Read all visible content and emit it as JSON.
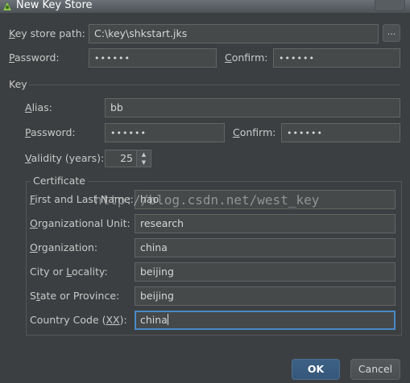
{
  "window": {
    "title": "New Key Store"
  },
  "keystore": {
    "path_label_key": "K",
    "path_label_rest": "ey store path:",
    "path_value": "C:\\key\\shkstart.jks",
    "browse_label": "...",
    "password_label_key": "P",
    "password_label_rest": "assword:",
    "password_value": "••••••",
    "confirm_label_key": "C",
    "confirm_label_rest": "onfirm:",
    "confirm_value": "••••••"
  },
  "key": {
    "section_label": "Key",
    "alias_label_key": "A",
    "alias_label_rest": "lias:",
    "alias_value": "bb",
    "password_label_key": "P",
    "password_label_rest": "assword:",
    "password_value": "••••••",
    "confirm_label_key": "C",
    "confirm_label_rest": "onfirm:",
    "confirm_value": "••••••",
    "validity_label_key": "V",
    "validity_label_rest": "alidity (years):",
    "validity_value": "25"
  },
  "certificate": {
    "section_label": "Certificate",
    "first_last_label_key": "F",
    "first_last_label_rest": "irst and Last Name:",
    "first_last_value": "hao",
    "org_unit_label_key": "O",
    "org_unit_label_rest": "rganizational Unit:",
    "org_unit_value": "research",
    "org_label_key": "O",
    "org_label_rest": "rganization:",
    "org_value": "china",
    "city_label_pre": "City or ",
    "city_label_key": "L",
    "city_label_rest": "ocality:",
    "city_value": "beijing",
    "state_label_pre": "S",
    "state_label_key": "t",
    "state_label_rest": "ate or Province:",
    "state_value": "beijing",
    "country_label_pre": "Country Code (",
    "country_label_key": "XX",
    "country_label_rest": "):",
    "country_value": "china"
  },
  "buttons": {
    "ok": "OK",
    "cancel": "Cancel"
  },
  "watermark": "http://blog.csdn.net/west_key",
  "colors": {
    "background": "#3c3f41",
    "focus": "#4a88c7",
    "ok_button": "#365880"
  }
}
